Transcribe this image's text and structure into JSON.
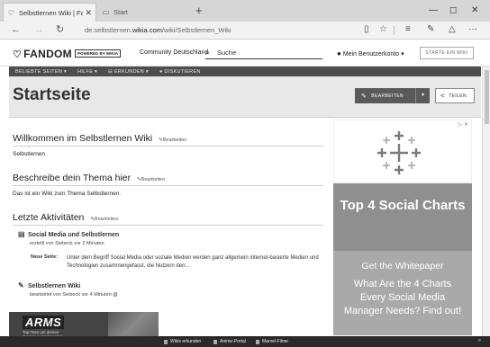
{
  "browser": {
    "tabs": [
      {
        "label": "Selbstlernen Wiki | Fand",
        "favicon": "heart-icon",
        "close": "✕"
      },
      {
        "label": "Start",
        "favicon": "page-icon"
      }
    ],
    "new_tab": "+",
    "window": {
      "min": "—",
      "max": "◻",
      "close": "✕"
    },
    "nav": {
      "back": "←",
      "forward": "→",
      "refresh": "↻"
    },
    "url_prefix": "de.selbstlernen.",
    "url_domain": "wikia.com",
    "url_path": "/wiki/Selbstlernen_Wiki",
    "tools": {
      "reading": "▯",
      "favorite": "☆",
      "hub": "≡",
      "note": "✎",
      "share": "△",
      "more": "···"
    }
  },
  "fandom": {
    "logo": "FANDOM",
    "powered": "POWERED BY WIKIA",
    "community": "Community Deutschland",
    "search_placeholder": "Suche",
    "account": "Mein Benutzerkonto",
    "account_caret": "▾",
    "start_wiki": "STARTE EIN WIKI"
  },
  "wiki_nav": [
    "BELIEBTE SEITEN ▾",
    "HILFE ▾",
    "ERKUNDEN ▾",
    "DISKUTIEREN"
  ],
  "page": {
    "title": "Startseite",
    "edit_label": "BEARBEITEN",
    "edit_dropdown": "▾",
    "share_label": "TEILEN"
  },
  "sections": [
    {
      "heading": "Willkommen im Selbstlernen Wiki",
      "edit": "Bearbeiten",
      "text": "Selbstlernen"
    },
    {
      "heading": "Beschreibe dein Thema hier",
      "edit": "Bearbeiten",
      "text": "Das ist ein Wiki zum Thema Selbstlernen."
    },
    {
      "heading": "Letzte Aktivitäten",
      "edit": "Bearbeiten"
    }
  ],
  "activity": [
    {
      "title": "Social Media und Selbstlernen",
      "meta": "erstellt von Siebeck vor 2 Minuten"
    },
    {
      "title": "Selbstlernen Wiki",
      "meta": "bearbeitet von Siebeck vor 4 Minuten"
    }
  ],
  "new_page": {
    "label": "Neue Seite:",
    "text": "Unter dem Begriff Social Media oder soziale Medien werden ganz allgemein internet-basierte Medien und Technologien zusammengefasst, die Nutzern den..."
  },
  "ad": {
    "marker": "▷ ✕",
    "headline": "Top 4 Social Charts",
    "body_line": "Get the Whitepaper",
    "cta": "What Are the 4 Charts Every Social Media Manager Needs? Find out!"
  },
  "bottom_ad": {
    "logo": "ARMS",
    "sub1": "Top-Toss um deinen",
    "sub2": "Gegner auszuknocken"
  },
  "footer": [
    "Wikis erkunden",
    "Anime-Portal",
    "Marvel-Filme"
  ],
  "footer_chevron": "»"
}
